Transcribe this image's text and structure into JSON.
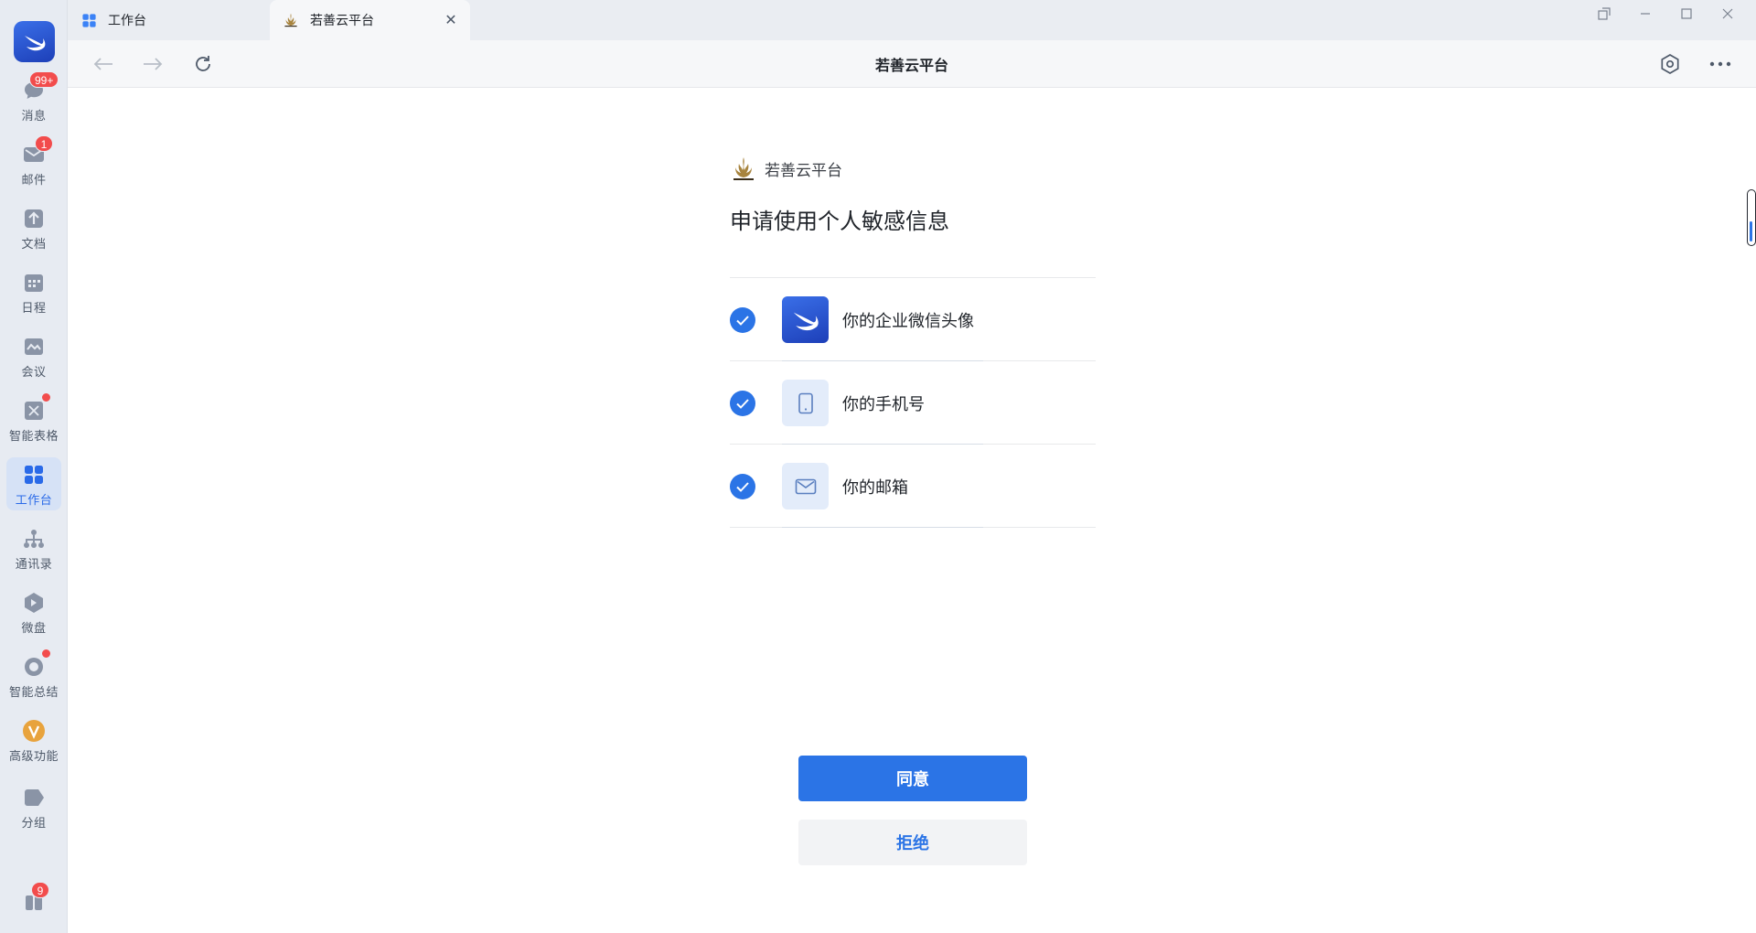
{
  "sidebar": {
    "app_logo_icon": "swift-bird-logo",
    "items": [
      {
        "name": "messages",
        "label": "消息",
        "icon": "chat-bubble-icon",
        "badge": "99+"
      },
      {
        "name": "mail",
        "label": "邮件",
        "icon": "mail-icon",
        "badge": "1"
      },
      {
        "name": "docs",
        "label": "文档",
        "icon": "document-icon"
      },
      {
        "name": "calendar",
        "label": "日程",
        "icon": "calendar-icon"
      },
      {
        "name": "meeting",
        "label": "会议",
        "icon": "meeting-icon"
      },
      {
        "name": "smart-sheet",
        "label": "智能表格",
        "icon": "smart-sheet-icon",
        "dot": true
      },
      {
        "name": "workbench",
        "label": "工作台",
        "icon": "grid-apps-icon",
        "active": true
      },
      {
        "name": "contacts",
        "label": "通讯录",
        "icon": "org-chart-icon"
      },
      {
        "name": "drive",
        "label": "微盘",
        "icon": "drive-icon"
      },
      {
        "name": "smart-summary",
        "label": "智能总结",
        "icon": "summary-icon",
        "dot": true
      },
      {
        "name": "advanced",
        "label": "高级功能",
        "icon": "vip-badge-icon"
      },
      {
        "name": "group",
        "label": "分组",
        "icon": "tag-icon"
      }
    ],
    "bottom_badge": "9"
  },
  "tabs": [
    {
      "label": "工作台",
      "icon": "grid-apps-icon"
    },
    {
      "label": "若善云平台",
      "icon": "ruoshan-logo-icon",
      "active": true
    }
  ],
  "toolbar": {
    "title": "若善云平台"
  },
  "auth": {
    "brand": "若善云平台",
    "heading": "申请使用个人敏感信息",
    "permissions": [
      {
        "label": "你的企业微信头像",
        "icon": "avatar-icon",
        "checked": true
      },
      {
        "label": "你的手机号",
        "icon": "phone-icon",
        "checked": true
      },
      {
        "label": "你的邮箱",
        "icon": "envelope-icon",
        "checked": true
      }
    ],
    "agree_label": "同意",
    "reject_label": "拒绝"
  },
  "colors": {
    "accent": "#2b74e6",
    "badge": "#f24c4c",
    "sidebar_bg": "#e7ebf2"
  }
}
